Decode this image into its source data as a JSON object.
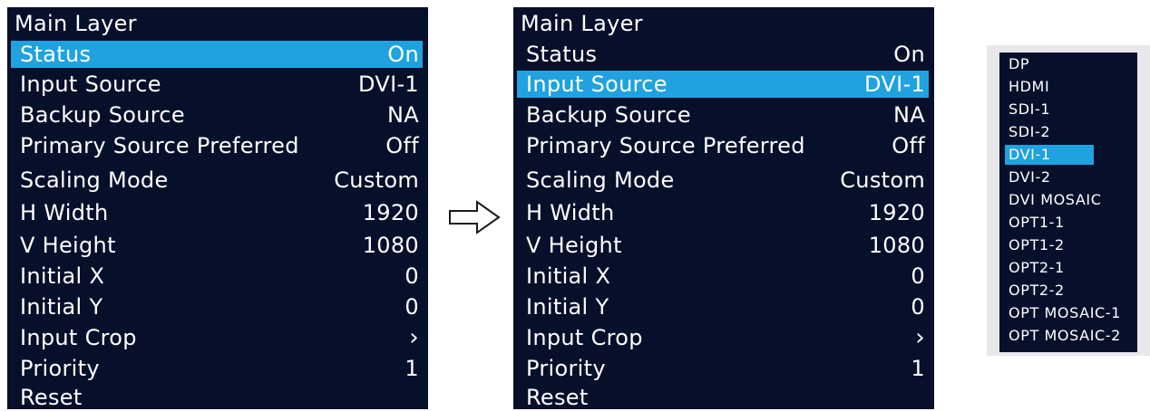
{
  "left_menu": {
    "title": "Main Layer",
    "rows": [
      {
        "label": "Status",
        "value": "On",
        "selected": true
      },
      {
        "label": "Input Source",
        "value": "DVI-1",
        "selected": false
      },
      {
        "label": "Backup Source",
        "value": "NA",
        "selected": false
      },
      {
        "label": "Primary Source Preferred",
        "value": "Off",
        "selected": false
      },
      {
        "label": "Scaling Mode",
        "value": "Custom",
        "selected": false
      },
      {
        "label": "H Width",
        "value": "1920",
        "selected": false
      },
      {
        "label": "V Height",
        "value": "1080",
        "selected": false
      },
      {
        "label": "Initial X",
        "value": "0",
        "selected": false
      },
      {
        "label": "Initial Y",
        "value": "0",
        "selected": false
      },
      {
        "label": "Input Crop",
        "value": "›",
        "selected": false
      },
      {
        "label": "Priority",
        "value": "1",
        "selected": false
      },
      {
        "label": "Reset",
        "value": "",
        "selected": false
      }
    ]
  },
  "right_menu": {
    "title": "Main Layer",
    "rows": [
      {
        "label": "Status",
        "value": "On",
        "selected": false
      },
      {
        "label": "Input Source",
        "value": "DVI-1",
        "selected": true
      },
      {
        "label": "Backup Source",
        "value": "NA",
        "selected": false
      },
      {
        "label": "Primary Source Preferred",
        "value": "Off",
        "selected": false
      },
      {
        "label": "Scaling Mode",
        "value": "Custom",
        "selected": false
      },
      {
        "label": "H Width",
        "value": "1920",
        "selected": false
      },
      {
        "label": "V Height",
        "value": "1080",
        "selected": false
      },
      {
        "label": "Initial X",
        "value": "0",
        "selected": false
      },
      {
        "label": "Initial Y",
        "value": "0",
        "selected": false
      },
      {
        "label": "Input Crop",
        "value": "›",
        "selected": false
      },
      {
        "label": "Priority",
        "value": "1",
        "selected": false
      },
      {
        "label": "Reset",
        "value": "",
        "selected": false
      }
    ]
  },
  "source_list": {
    "options": [
      "DP",
      "HDMI",
      "SDI-1",
      "SDI-2",
      "DVI-1",
      "DVI-2",
      "DVI MOSAIC",
      "OPT1-1",
      "OPT1-2",
      "OPT2-1",
      "OPT2-2",
      "OPT MOSAIC-1",
      "OPT MOSAIC-2"
    ],
    "selected": "DVI-1"
  },
  "icons": {
    "transition_arrow": "right-arrow-outline-icon",
    "submenu": "chevron-right-icon"
  },
  "colors": {
    "panel_bg": "#07102b",
    "highlight": "#1fa2df",
    "text": "#ffffff",
    "dropdown_frame": "#e8e8ec"
  }
}
